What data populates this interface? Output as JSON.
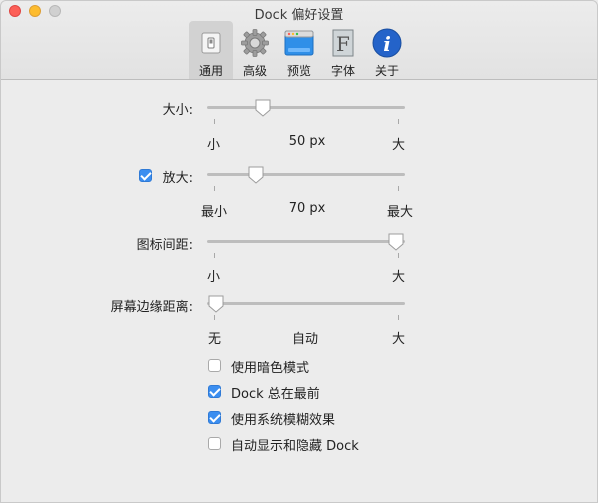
{
  "window": {
    "title": "Dock 偏好设置"
  },
  "toolbar": {
    "items": [
      {
        "label": "通用",
        "icon": "general-icon",
        "active": true
      },
      {
        "label": "高级",
        "icon": "gear-icon"
      },
      {
        "label": "预览",
        "icon": "preview-window-icon"
      },
      {
        "label": "字体",
        "icon": "font-icon"
      },
      {
        "label": "关于",
        "icon": "info-icon"
      }
    ]
  },
  "settings": {
    "size": {
      "label": "大小:",
      "min": "小",
      "value": "50 px",
      "max": "大",
      "level": 0.26
    },
    "magnification": {
      "label": "放大:",
      "checked": true,
      "min": "最小",
      "value": "70 px",
      "max": "最大",
      "level": 0.22
    },
    "icon_spacing": {
      "label": "图标间距:",
      "min": "小",
      "max": "大",
      "level": 1.0
    },
    "screen_edge_distance": {
      "label": "屏幕边缘距离:",
      "min": "无",
      "value": "自动",
      "max": "大",
      "level": 0.0
    }
  },
  "options": [
    {
      "label": "使用暗色模式",
      "checked": false
    },
    {
      "label": "Dock 总在最前",
      "checked": true
    },
    {
      "label": "使用系统模糊效果",
      "checked": true
    },
    {
      "label": "自动显示和隐藏 Dock",
      "checked": false
    }
  ],
  "colors": {
    "accent": "#3b8ef0",
    "close": "#fc5f57",
    "minimize": "#fdbc2e"
  }
}
